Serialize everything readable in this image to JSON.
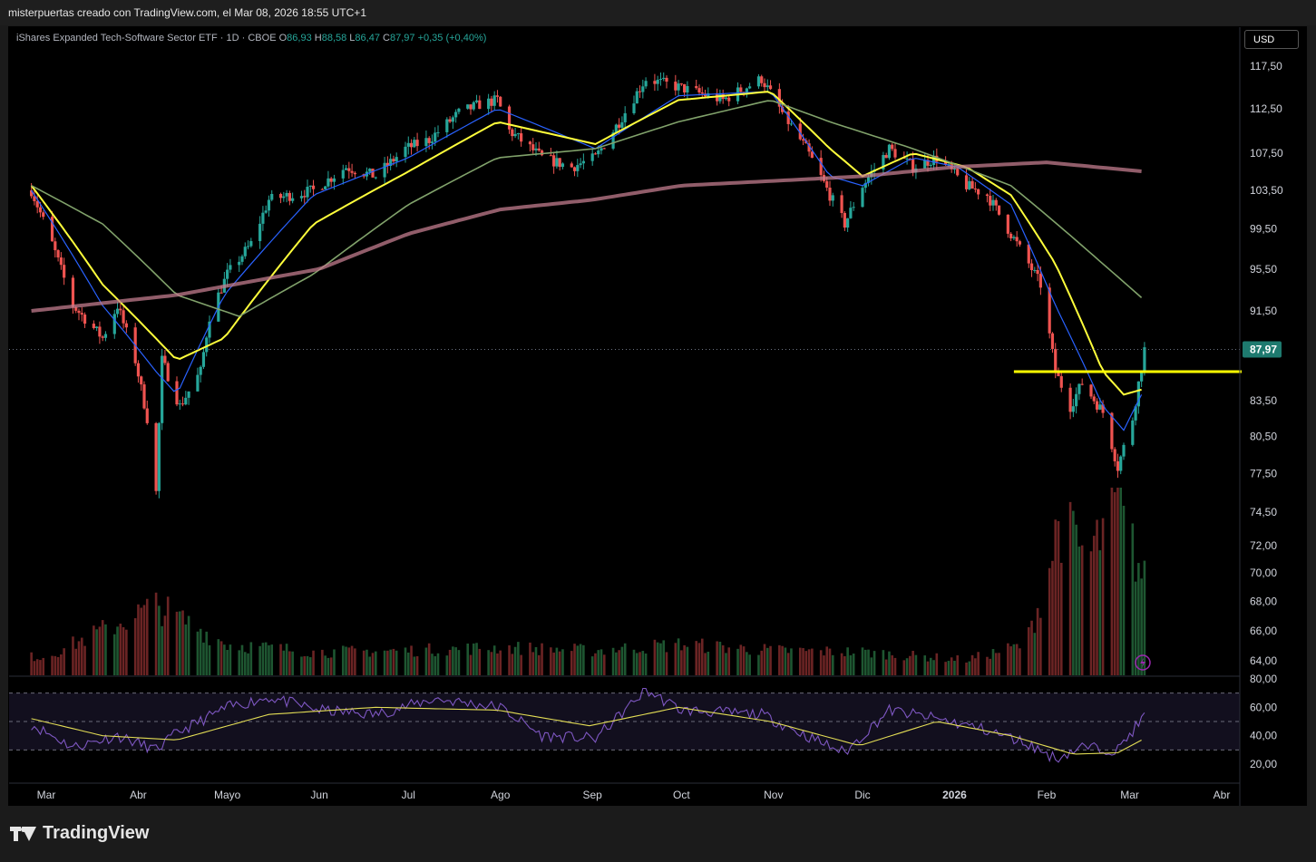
{
  "header": {
    "caption": "misterpuertas creado con TradingView.com, el Mar 08, 2026 18:55 UTC+1"
  },
  "legend": {
    "symbol": "iShares Expanded Tech-Software Sector ETF · 1D · CBOE",
    "o_label": "O",
    "o_value": "86,93",
    "h_label": "H",
    "h_value": "88,58",
    "l_label": "L",
    "l_value": "86,47",
    "c_label": "C",
    "c_value": "87,97",
    "change": "+0,35 (+0,40%)"
  },
  "currency_button": "USD",
  "brand": "TradingView",
  "colors": {
    "up": "#26a69a",
    "down": "#ef5350",
    "ma_fast": "#2962ff",
    "ma_yellow": "#ffff3b",
    "ma_green": "#81a26b",
    "ma_200": "#c27c8e",
    "rsi": "#7e57c2",
    "rsi_ma": "#e3dd55",
    "level_line": "#ffff00",
    "price_label_bg": "#1e7a6f"
  },
  "chart_data": [
    {
      "type": "candlestick",
      "title": "iShares Expanded Tech-Software Sector ETF",
      "timeframe": "1D",
      "exchange": "CBOE",
      "currency": "USD",
      "x_tick_labels": [
        "Mar",
        "Abr",
        "Mayo",
        "Jun",
        "Jul",
        "Ago",
        "Sep",
        "Oct",
        "Nov",
        "Dic",
        "2026",
        "Feb",
        "Mar",
        "Abr"
      ],
      "y_tick_labels": [
        "117,50",
        "112,50",
        "107,50",
        "103,50",
        "99,50",
        "95,50",
        "91,50",
        "87,97",
        "83,50",
        "80,50",
        "77,50",
        "74,50",
        "72,00",
        "70,00",
        "68,00",
        "66,00",
        "64,00"
      ],
      "y_scale": "log",
      "ylim": [
        62.6,
        120
      ],
      "last_price": "87,97",
      "horizontal_level": 86.0,
      "price_path": [
        [
          "2025-02-24",
          103.5
        ],
        [
          "2025-03-03",
          98
        ],
        [
          "2025-03-10",
          92
        ],
        [
          "2025-03-20",
          89
        ],
        [
          "2025-03-25",
          92
        ],
        [
          "2025-03-31",
          87
        ],
        [
          "2025-04-04",
          82
        ],
        [
          "2025-04-07",
          76
        ],
        [
          "2025-04-09",
          87
        ],
        [
          "2025-04-15",
          83
        ],
        [
          "2025-04-22",
          86
        ],
        [
          "2025-04-25",
          91
        ],
        [
          "2025-05-01",
          95
        ],
        [
          "2025-05-09",
          98
        ],
        [
          "2025-05-15",
          102.5
        ],
        [
          "2025-05-30",
          103.5
        ],
        [
          "2025-06-10",
          106
        ],
        [
          "2025-06-20",
          105
        ],
        [
          "2025-06-30",
          108
        ],
        [
          "2025-07-08",
          109
        ],
        [
          "2025-07-18",
          112
        ],
        [
          "2025-07-25",
          113
        ],
        [
          "2025-07-31",
          113.5
        ],
        [
          "2025-08-04",
          110
        ],
        [
          "2025-08-15",
          107
        ],
        [
          "2025-08-25",
          106
        ],
        [
          "2025-09-02",
          107
        ],
        [
          "2025-09-10",
          111
        ],
        [
          "2025-09-19",
          116
        ],
        [
          "2025-09-30",
          115
        ],
        [
          "2025-10-15",
          113.5
        ],
        [
          "2025-10-28",
          116
        ],
        [
          "2025-11-04",
          112
        ],
        [
          "2025-11-12",
          108
        ],
        [
          "2025-11-20",
          103
        ],
        [
          "2025-11-25",
          100
        ],
        [
          "2025-12-01",
          104
        ],
        [
          "2025-12-10",
          108
        ],
        [
          "2025-12-18",
          106
        ],
        [
          "2025-12-26",
          107
        ],
        [
          "2026-01-05",
          104
        ],
        [
          "2026-01-12",
          103
        ],
        [
          "2026-01-20",
          99
        ],
        [
          "2026-01-26",
          96
        ],
        [
          "2026-01-30",
          94
        ],
        [
          "2026-02-04",
          86
        ],
        [
          "2026-02-09",
          83
        ],
        [
          "2026-02-13",
          85
        ],
        [
          "2026-02-20",
          82.5
        ],
        [
          "2026-02-25",
          78
        ],
        [
          "2026-03-02",
          82
        ],
        [
          "2026-03-06",
          87.97
        ]
      ],
      "moving_averages": [
        {
          "path": [
            [
              "2025-02-24",
              103.5
            ],
            [
              "2025-03-20",
              92
            ],
            [
              "2025-04-07",
              86
            ],
            [
              "2025-04-14",
              84
            ],
            [
              "2025-04-30",
              93
            ],
            [
              "2025-05-30",
              103
            ],
            [
              "2025-07-01",
              107
            ],
            [
              "2025-07-31",
              112.5
            ],
            [
              "2025-09-02",
              108
            ],
            [
              "2025-09-30",
              114
            ],
            [
              "2025-10-31",
              114.5
            ],
            [
              "2025-11-20",
              105
            ],
            [
              "2025-12-01",
              104
            ],
            [
              "2025-12-18",
              107
            ],
            [
              "2026-01-02",
              106
            ],
            [
              "2026-01-20",
              102
            ],
            [
              "2026-02-04",
              92
            ],
            [
              "2026-02-20",
              83
            ],
            [
              "2026-02-27",
              81
            ],
            [
              "2026-03-06",
              84.5
            ]
          ]
        },
        {
          "path": [
            [
              "2025-02-24",
              104
            ],
            [
              "2025-03-20",
              94
            ],
            [
              "2025-04-14",
              87
            ],
            [
              "2025-04-30",
              89
            ],
            [
              "2025-05-30",
              100
            ],
            [
              "2025-07-01",
              105.5
            ],
            [
              "2025-07-31",
              111
            ],
            [
              "2025-09-02",
              108.5
            ],
            [
              "2025-09-30",
              113.5
            ],
            [
              "2025-10-31",
              114.5
            ],
            [
              "2025-11-20",
              108
            ],
            [
              "2025-12-01",
              105
            ],
            [
              "2025-12-18",
              107.5
            ],
            [
              "2026-01-05",
              106
            ],
            [
              "2026-01-20",
              103
            ],
            [
              "2026-02-04",
              96
            ],
            [
              "2026-02-20",
              86
            ],
            [
              "2026-02-27",
              84
            ],
            [
              "2026-03-06",
              84.5
            ]
          ]
        },
        {
          "path": [
            [
              "2025-02-24",
              104
            ],
            [
              "2025-03-20",
              100
            ],
            [
              "2025-04-14",
              93
            ],
            [
              "2025-05-05",
              91
            ],
            [
              "2025-05-30",
              95
            ],
            [
              "2025-07-01",
              102
            ],
            [
              "2025-07-31",
              107
            ],
            [
              "2025-09-02",
              108
            ],
            [
              "2025-09-30",
              111
            ],
            [
              "2025-10-31",
              113.5
            ],
            [
              "2025-11-20",
              111
            ],
            [
              "2025-12-18",
              108
            ],
            [
              "2026-01-20",
              104
            ],
            [
              "2026-02-20",
              96
            ],
            [
              "2026-03-06",
              92.5
            ]
          ]
        },
        {
          "path": [
            [
              "2025-02-24",
              91.5
            ],
            [
              "2025-04-14",
              93
            ],
            [
              "2025-06-01",
              95.5
            ],
            [
              "2025-07-01",
              99
            ],
            [
              "2025-08-01",
              101.5
            ],
            [
              "2025-09-01",
              102.5
            ],
            [
              "2025-10-01",
              104
            ],
            [
              "2025-11-01",
              104.5
            ],
            [
              "2025-12-01",
              105
            ],
            [
              "2026-01-01",
              106
            ],
            [
              "2026-02-01",
              106.5
            ],
            [
              "2026-03-06",
              105.5
            ]
          ]
        }
      ],
      "volume_relative": [
        [
          "2025-03-01",
          0.12
        ],
        [
          "2025-04-07",
          0.45
        ],
        [
          "2025-05-01",
          0.2
        ],
        [
          "2025-06-01",
          0.15
        ],
        [
          "2025-07-01",
          0.16
        ],
        [
          "2025-08-01",
          0.18
        ],
        [
          "2025-09-01",
          0.16
        ],
        [
          "2025-10-01",
          0.2
        ],
        [
          "2025-11-01",
          0.16
        ],
        [
          "2025-12-01",
          0.15
        ],
        [
          "2026-01-05",
          0.1
        ],
        [
          "2026-01-25",
          0.2
        ],
        [
          "2026-02-01",
          0.6
        ],
        [
          "2026-02-05",
          1.0
        ],
        [
          "2026-02-15",
          0.75
        ],
        [
          "2026-02-25",
          1.1
        ],
        [
          "2026-03-06",
          0.6
        ]
      ]
    },
    {
      "type": "line",
      "title": "RSI",
      "y_tick_labels": [
        "80,00",
        "60,00",
        "40,00",
        "20,00"
      ],
      "ylim": [
        10,
        82
      ],
      "reference_levels": [
        70,
        50,
        30
      ],
      "series": [
        {
          "values": [
            [
              "2025-02-24",
              48
            ],
            [
              "2025-03-10",
              32
            ],
            [
              "2025-03-25",
              40
            ],
            [
              "2025-04-07",
              30
            ],
            [
              "2025-04-14",
              42
            ],
            [
              "2025-05-01",
              60
            ],
            [
              "2025-05-15",
              67
            ],
            [
              "2025-06-01",
              58
            ],
            [
              "2025-06-20",
              55
            ],
            [
              "2025-07-10",
              66
            ],
            [
              "2025-08-01",
              60
            ],
            [
              "2025-08-15",
              40
            ],
            [
              "2025-09-02",
              38
            ],
            [
              "2025-09-19",
              72
            ],
            [
              "2025-10-01",
              58
            ],
            [
              "2025-10-28",
              55
            ],
            [
              "2025-11-12",
              40
            ],
            [
              "2025-11-25",
              28
            ],
            [
              "2025-12-10",
              58
            ],
            [
              "2025-12-26",
              52
            ],
            [
              "2026-01-10",
              45
            ],
            [
              "2026-01-25",
              35
            ],
            [
              "2026-02-04",
              24
            ],
            [
              "2026-02-13",
              32
            ],
            [
              "2026-02-25",
              30
            ],
            [
              "2026-03-06",
              54
            ]
          ]
        },
        {
          "values": [
            [
              "2025-02-24",
              52
            ],
            [
              "2025-03-20",
              40
            ],
            [
              "2025-04-14",
              37
            ],
            [
              "2025-05-15",
              55
            ],
            [
              "2025-06-20",
              60
            ],
            [
              "2025-07-31",
              58
            ],
            [
              "2025-08-31",
              47
            ],
            [
              "2025-09-30",
              60
            ],
            [
              "2025-10-31",
              50
            ],
            [
              "2025-11-30",
              33
            ],
            [
              "2025-12-26",
              50
            ],
            [
              "2026-01-20",
              40
            ],
            [
              "2026-02-10",
              27
            ],
            [
              "2026-02-25",
              28
            ],
            [
              "2026-03-06",
              38
            ]
          ]
        }
      ]
    }
  ]
}
